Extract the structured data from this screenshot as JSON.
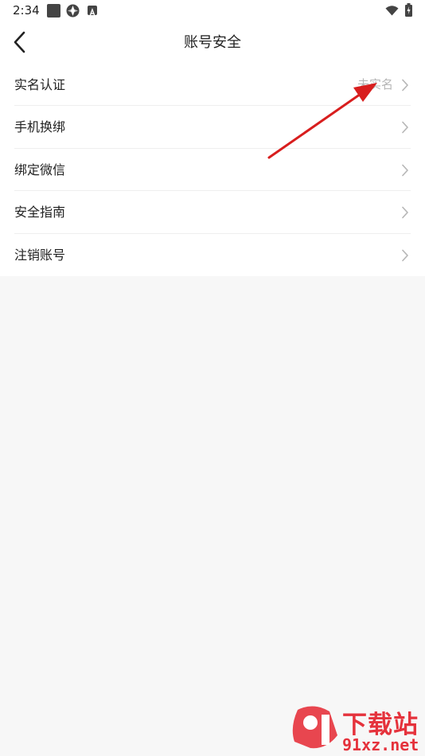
{
  "status_bar": {
    "time": "2:34",
    "icons": [
      "app-square-icon",
      "app-logo-icon",
      "a-notification-icon",
      "wifi-icon",
      "battery-icon"
    ]
  },
  "header": {
    "title": "账号安全",
    "back_icon": "chevron-left-icon"
  },
  "list": {
    "items": [
      {
        "label": "实名认证",
        "value": "未实名"
      },
      {
        "label": "手机换绑",
        "value": ""
      },
      {
        "label": "绑定微信",
        "value": ""
      },
      {
        "label": "安全指南",
        "value": ""
      },
      {
        "label": "注销账号",
        "value": ""
      }
    ]
  },
  "colors": {
    "background": "#f7f7f7",
    "surface": "#ffffff",
    "text": "#222222",
    "muted": "#b6b6b6",
    "annotation": "#d81e1e",
    "watermark": "#e5323c"
  },
  "watermark": {
    "top": "下载站",
    "bottom": "91xz.net"
  }
}
